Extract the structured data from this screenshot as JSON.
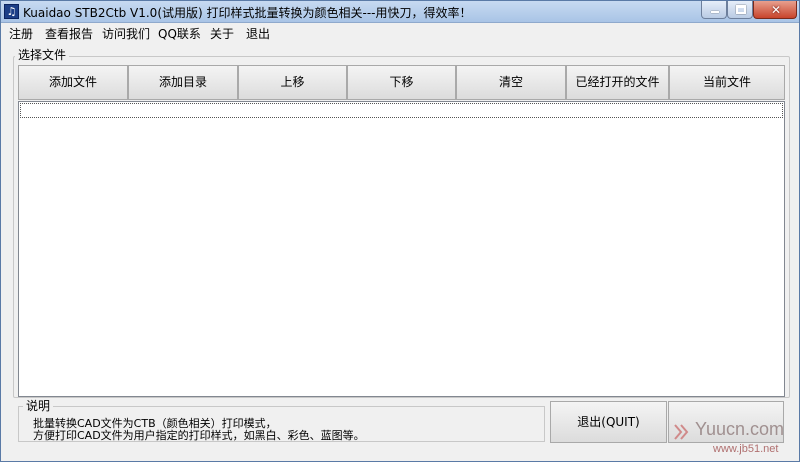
{
  "window": {
    "icon_glyph": "♫",
    "title": "Kuaidao STB2Ctb  V1.0(试用版) 打印样式批量转换为颜色相关---用快刀，得效率！",
    "minimize_glyph": "",
    "maximize_glyph": "",
    "close_glyph": "✕"
  },
  "menu": [
    {
      "label": "注册"
    },
    {
      "label": "查看报告"
    },
    {
      "label": "访问我们"
    },
    {
      "label": "QQ联系"
    },
    {
      "label": "关于"
    },
    {
      "label": "退出"
    }
  ],
  "file_group": {
    "legend": "选择文件",
    "buttons": [
      {
        "label": "添加文件"
      },
      {
        "label": "添加目录"
      },
      {
        "label": "上移"
      },
      {
        "label": "下移"
      },
      {
        "label": "清空"
      },
      {
        "label": "已经打开的文件"
      },
      {
        "label": "当前文件"
      }
    ],
    "files": []
  },
  "description": {
    "legend": "说明",
    "line1": "批量转换CAD文件为CTB（颜色相关）打印模式，",
    "line2": "方便打印CAD文件为用户指定的打印样式，如黑白、彩色、蓝图等。"
  },
  "quit_button": {
    "label": "退出(QUIT)"
  },
  "watermark": {
    "main": "Yuucn.com",
    "sub": "www.jb51.net"
  },
  "colors": {
    "titlebar": "#a9c4e6",
    "close_button": "#c8442c",
    "window_bg": "#f0f0f0"
  }
}
